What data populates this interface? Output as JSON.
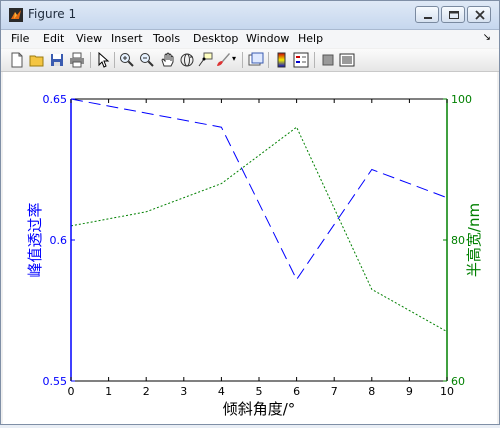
{
  "window": {
    "title": "Figure 1",
    "icon": "matlab-icon"
  },
  "menu": [
    "File",
    "Edit",
    "View",
    "Insert",
    "Tools",
    "Desktop",
    "Window",
    "Help"
  ],
  "menu_overflow": "↘",
  "toolbar": [
    "new-figure-icon",
    "open-file-icon",
    "save-icon",
    "print-icon",
    "pointer-icon",
    "zoom-in-icon",
    "zoom-out-icon",
    "pan-icon",
    "rotate-3d-icon",
    "data-cursor-icon",
    "brush-icon",
    "link-plot-icon",
    "colorbar-icon",
    "legend-icon",
    "hide-plot-tools-icon",
    "show-plot-tools-icon"
  ],
  "colors": {
    "left_axis": "#0000ff",
    "right_axis": "#008000",
    "series_left": "#0000ff",
    "series_right": "#008000"
  },
  "chart_data": {
    "type": "line",
    "xlabel": "倾斜角度/°",
    "ylabel_left": "峰值透过率",
    "ylabel_right": "半高宽/nm",
    "xlim": [
      0,
      10
    ],
    "ylim_left": [
      0.55,
      0.65
    ],
    "ylim_right": [
      60,
      100
    ],
    "x_ticks": [
      "0",
      "1",
      "2",
      "3",
      "4",
      "5",
      "6",
      "7",
      "8",
      "9",
      "10"
    ],
    "y_ticks_left": [
      "0.55",
      "0.6",
      "0.65"
    ],
    "y_ticks_right": [
      "60",
      "80",
      "100"
    ],
    "grid": false,
    "series": [
      {
        "axis": "left",
        "line_style": "dashed",
        "x": [
          0,
          2,
          4,
          6,
          8,
          10
        ],
        "y": [
          0.65,
          0.645,
          0.64,
          0.586,
          0.625,
          0.615
        ]
      },
      {
        "axis": "right",
        "line_style": "dotted",
        "x": [
          0,
          2,
          4,
          6,
          8,
          10
        ],
        "y": [
          82,
          84,
          88,
          96,
          73,
          67
        ]
      }
    ]
  }
}
